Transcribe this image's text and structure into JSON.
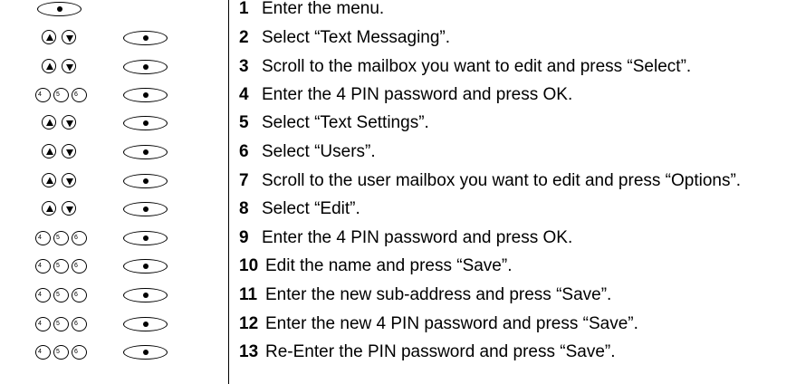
{
  "steps": [
    {
      "number": "1",
      "text": "Enter the menu.",
      "keys": [
        "softkey"
      ]
    },
    {
      "number": "2",
      "text": "Select “Text Messaging”.",
      "keys": [
        "nav-up-down",
        "softkey"
      ]
    },
    {
      "number": "3",
      "text": "Scroll to the mailbox you want to edit and press “Select”.",
      "keys": [
        "nav-up-down",
        "softkey"
      ]
    },
    {
      "number": "4",
      "text": "Enter the 4 PIN password and press OK.",
      "keys": [
        "keypad-digits",
        "softkey"
      ]
    },
    {
      "number": "5",
      "text": "Select “Text Settings”.",
      "keys": [
        "nav-up-down",
        "softkey"
      ]
    },
    {
      "number": "6",
      "text": "Select “Users”.",
      "keys": [
        "nav-up-down",
        "softkey"
      ]
    },
    {
      "number": "7",
      "text": "Scroll to the user mailbox you want to edit and press “Options”.",
      "keys": [
        "nav-up-down",
        "softkey"
      ]
    },
    {
      "number": "8",
      "text": "Select “Edit”.",
      "keys": [
        "nav-up-down",
        "softkey"
      ]
    },
    {
      "number": "9",
      "text": "Enter the 4 PIN password and press OK.",
      "keys": [
        "keypad-digits",
        "softkey"
      ]
    },
    {
      "number": "10",
      "text": "Edit the name and press “Save”.",
      "keys": [
        "keypad-digits",
        "softkey"
      ]
    },
    {
      "number": "11",
      "text": "Enter the new sub-address and press “Save”.",
      "keys": [
        "keypad-digits",
        "softkey"
      ]
    },
    {
      "number": "12",
      "text": "Enter the new 4 PIN password and press “Save”.",
      "keys": [
        "keypad-digits",
        "softkey"
      ]
    },
    {
      "number": "13",
      "text": "Re-Enter the PIN password and press “Save”.",
      "keys": [
        "keypad-digits",
        "softkey"
      ]
    }
  ],
  "keypad_digits": [
    "4",
    "5",
    "6"
  ]
}
